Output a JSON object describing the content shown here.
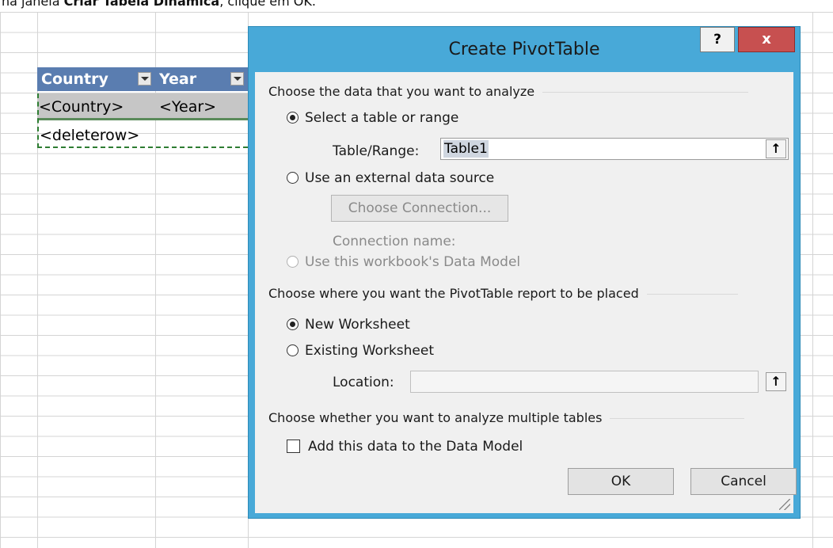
{
  "caption": {
    "prefix": "na janela ",
    "bold": "Criar Tabela Dinâmica",
    "suffix": ", clique em OK."
  },
  "sheet": {
    "headers": [
      "Country",
      "Year"
    ],
    "row1": [
      "<Country>",
      "<Year>"
    ],
    "row2": "<deleterow>"
  },
  "dialog": {
    "title": "Create PivotTable",
    "help_label": "?",
    "close_label": "x",
    "section1": "Choose the data that you want to analyze",
    "radio_select_table": "Select a table or range",
    "table_range_label": "Table/Range:",
    "table_range_value": "Table1",
    "radio_external": "Use an external data source",
    "choose_connection": "Choose Connection...",
    "connection_name_label": "Connection name:",
    "radio_data_model": "Use this workbook's Data Model",
    "section2": "Choose where you want the PivotTable report to be placed",
    "radio_new_ws": "New Worksheet",
    "radio_existing_ws": "Existing Worksheet",
    "location_label": "Location:",
    "location_value": "",
    "section3": "Choose whether you want to analyze multiple tables",
    "add_to_model": "Add this data to the Data Model",
    "ok": "OK",
    "cancel": "Cancel",
    "collapse_icon": "↑"
  }
}
